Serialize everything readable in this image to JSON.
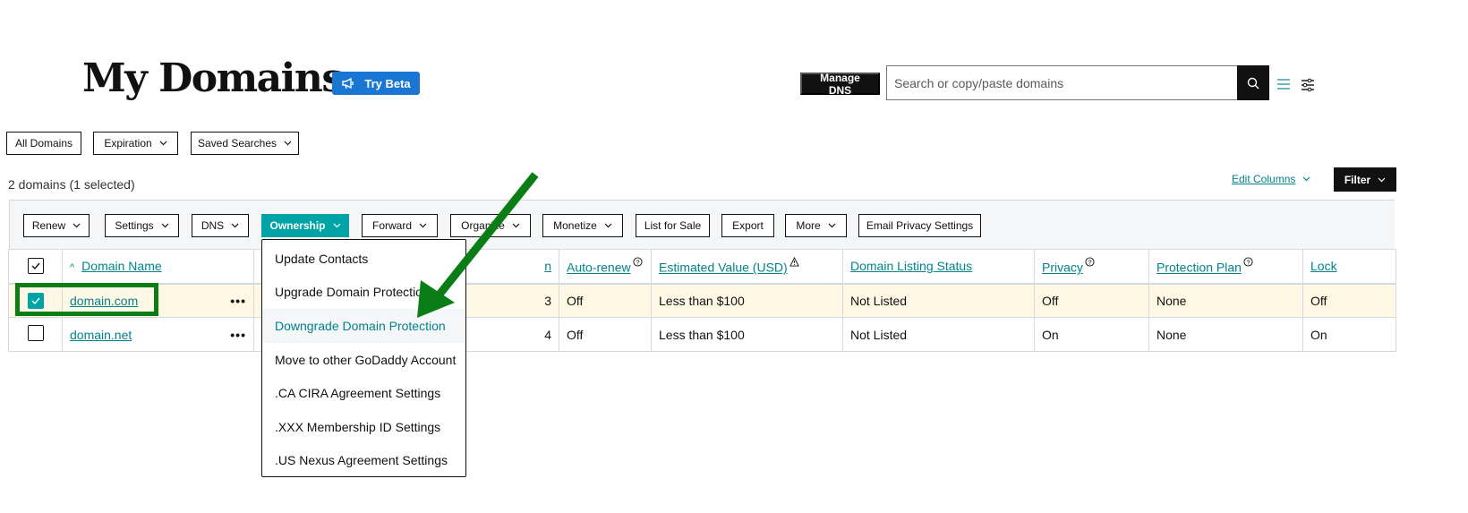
{
  "header": {
    "title": "My Domains",
    "try_beta_label": "Try Beta",
    "manage_dns_label": "Manage DNS",
    "search_placeholder": "Search or copy/paste domains",
    "search_value": ""
  },
  "filter_tabs": [
    {
      "label": "All Domains"
    },
    {
      "label": "Expiration"
    },
    {
      "label": "Saved Searches"
    }
  ],
  "summary": {
    "count_text": "2 domains (1 selected)",
    "edit_columns_label": "Edit Columns",
    "filter_label": "Filter"
  },
  "toolbar": [
    {
      "label": "Renew",
      "dropdown": true
    },
    {
      "label": "Settings",
      "dropdown": true
    },
    {
      "label": "DNS",
      "dropdown": true
    },
    {
      "label": "Ownership",
      "dropdown": true,
      "active": true
    },
    {
      "label": "Forward",
      "dropdown": true
    },
    {
      "label": "Organize",
      "dropdown": true
    },
    {
      "label": "Monetize",
      "dropdown": true
    },
    {
      "label": "List for Sale",
      "dropdown": false
    },
    {
      "label": "Export",
      "dropdown": false
    },
    {
      "label": "More",
      "dropdown": true
    },
    {
      "label": "Email Privacy Settings",
      "dropdown": false
    }
  ],
  "ownership_menu": {
    "items": [
      {
        "label": "Update Contacts"
      },
      {
        "label": "Upgrade Domain Protection"
      },
      {
        "label": "Downgrade Domain Protection",
        "hovered": true
      },
      {
        "label": "Move to other GoDaddy Account"
      },
      {
        "label": ".CA CIRA Agreement Settings"
      },
      {
        "label": ".XXX Membership ID Settings"
      },
      {
        "label": ".US Nexus Agreement Settings"
      }
    ]
  },
  "table": {
    "columns": {
      "domain_name": "Domain Name",
      "hidden": "n",
      "auto_renew": "Auto-renew",
      "estimated_value": "Estimated Value (USD)",
      "listing_status": "Domain Listing Status",
      "privacy": "Privacy",
      "protection_plan": "Protection Plan",
      "lock": "Lock"
    },
    "rows": [
      {
        "domain": "domain.com",
        "selected": true,
        "hidden": "3",
        "auto_renew": "Off",
        "estimated_value": "Less than $100",
        "listing_status": "Not Listed",
        "privacy": "Off",
        "protection_plan": "None",
        "lock": "Off"
      },
      {
        "domain": "domain.net",
        "selected": false,
        "hidden": "4",
        "auto_renew": "Off",
        "estimated_value": "Less than $100",
        "listing_status": "Not Listed",
        "privacy": "On",
        "protection_plan": "None",
        "lock": "On"
      }
    ],
    "row_menu_label": "•••"
  },
  "colors": {
    "accent_teal": "#00a4a6",
    "link_teal": "#00838c",
    "beta_blue": "#1976d2",
    "selected_row": "#fff8e5",
    "annotation_green": "#0a7d16"
  }
}
